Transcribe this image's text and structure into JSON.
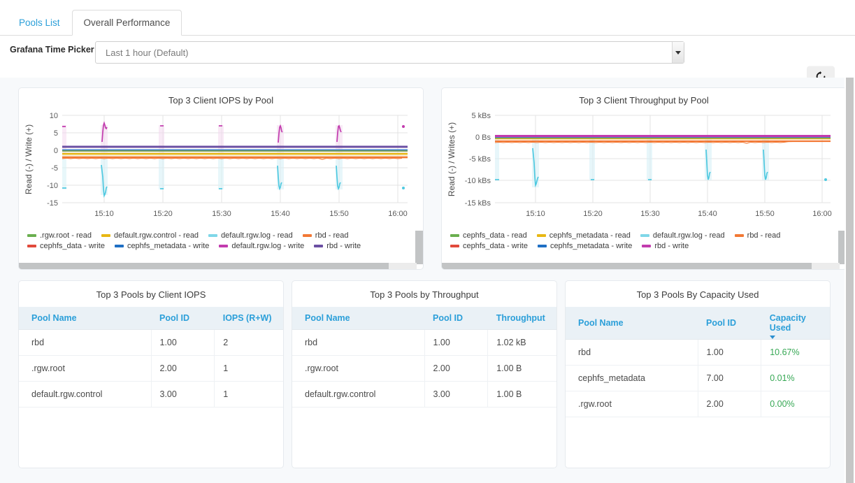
{
  "tabs": [
    {
      "label": "Pools List",
      "active": false
    },
    {
      "label": "Overall Performance",
      "active": true
    }
  ],
  "toolbar": {
    "picker_label": "Grafana Time Picker",
    "time_value": "Last 1 hour (Default)",
    "refresh_icon": "refresh-icon"
  },
  "colors": {
    "link": "#2b9fd9",
    "green": "#37a855",
    "header_bg": "#eaf1f6",
    "page_bg": "#f7f9fb",
    "series_green": "#6aaf4f",
    "series_yellow": "#e8b713",
    "series_cyan": "#7fd7e8",
    "series_orange": "#f27935",
    "series_red": "#e14a3b",
    "series_blue": "#1f6fc4",
    "series_magenta": "#c23bae",
    "series_purple": "#6b4fa3"
  },
  "chart_data": [
    {
      "type": "line",
      "title": "Top 3 Client IOPS by Pool",
      "xlabel": "",
      "ylabel": "Read (-) / Write (+)",
      "xticks": [
        "15:10",
        "15:20",
        "15:30",
        "15:40",
        "15:50",
        "16:00"
      ],
      "yticks": [
        "10",
        "5",
        "0",
        "-5",
        "-10",
        "-15"
      ],
      "ylim": [
        -15,
        10
      ],
      "grid": true,
      "legend_position": "bottom",
      "series": [
        {
          "name": ".rgw.root - read",
          "color": "#6aaf4f",
          "baseline": -0.2
        },
        {
          "name": "default.rgw.control - read",
          "color": "#e8b713",
          "baseline": -1.0
        },
        {
          "name": "default.rgw.log - read",
          "color": "#7fd7e8",
          "baseline": -10.2,
          "spikes": [
            -12.7,
            -12.6,
            -10.3,
            -10.3,
            -10.3,
            -10.3
          ]
        },
        {
          "name": "rbd - read",
          "color": "#f27935",
          "baseline": -2.0
        },
        {
          "name": "cephfs_data - write",
          "color": "#e14a3b",
          "baseline": 0.1
        },
        {
          "name": "cephfs_metadata - write",
          "color": "#1f6fc4",
          "baseline": 0.3
        },
        {
          "name": "default.rgw.log - write",
          "color": "#c23bae",
          "baseline": 7.5,
          "spikes": [
            9.0,
            7.6,
            7.5,
            7.5,
            7.4,
            7.5
          ]
        },
        {
          "name": "rbd - write",
          "color": "#6b4fa3",
          "baseline": 1.0
        }
      ]
    },
    {
      "type": "line",
      "title": "Top 3 Client Throughput by Pool",
      "xlabel": "",
      "ylabel": "Read (-) / Writes (+)",
      "xticks": [
        "15:10",
        "15:20",
        "15:30",
        "15:40",
        "15:50",
        "16:00"
      ],
      "yticks": [
        "5 kBs",
        "0 Bs",
        "-5 kBs",
        "-10 kBs",
        "-15 kBs"
      ],
      "ylim": [
        -15,
        5
      ],
      "grid": true,
      "legend_position": "bottom",
      "series": [
        {
          "name": "cephfs_data - read",
          "color": "#6aaf4f",
          "baseline": -0.1
        },
        {
          "name": "cephfs_metadata - read",
          "color": "#e8b713",
          "baseline": -0.15
        },
        {
          "name": "default.rgw.log - read",
          "color": "#7fd7e8",
          "baseline": -9.7,
          "spikes": [
            -11.8,
            -9.8,
            -9.8,
            -9.8,
            -9.8,
            -9.8
          ]
        },
        {
          "name": "rbd - read",
          "color": "#f27935",
          "baseline": -0.9
        },
        {
          "name": "cephfs_data - write",
          "color": "#e14a3b",
          "baseline": -0.05
        },
        {
          "name": "cephfs_metadata - write",
          "color": "#1f6fc4",
          "baseline": 0.0
        },
        {
          "name": "rbd - write",
          "color": "#c23bae",
          "baseline": 0.1
        }
      ]
    }
  ],
  "tables": [
    {
      "title": "Top 3 Pools by Client IOPS",
      "columns": [
        "Pool Name",
        "Pool ID",
        "IOPS (R+W)"
      ],
      "rows": [
        [
          "rbd",
          "1.00",
          "2"
        ],
        [
          ".rgw.root",
          "2.00",
          "1"
        ],
        [
          "default.rgw.control",
          "3.00",
          "1"
        ]
      ]
    },
    {
      "title": "Top 3 Pools by Throughput",
      "columns": [
        "Pool Name",
        "Pool ID",
        "Throughput"
      ],
      "rows": [
        [
          "rbd",
          "1.00",
          "1.02 kB"
        ],
        [
          ".rgw.root",
          "2.00",
          "1.00 B"
        ],
        [
          "default.rgw.control",
          "3.00",
          "1.00 B"
        ]
      ]
    },
    {
      "title": "Top 3 Pools By Capacity Used",
      "columns": [
        "Pool Name",
        "Pool ID",
        "Capacity Used"
      ],
      "sorted_column": 2,
      "rows": [
        [
          "rbd",
          "1.00",
          "10.67%"
        ],
        [
          "cephfs_metadata",
          "7.00",
          "0.01%"
        ],
        [
          ".rgw.root",
          "2.00",
          "0.00%"
        ]
      ]
    }
  ]
}
